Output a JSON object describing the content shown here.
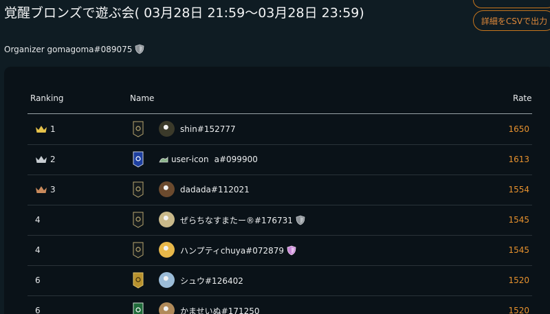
{
  "header": {
    "title": "覚醒ブロンズで遊ぶ会( 03月28日 21:59〜03月28日 23:59)",
    "csv_button": "詳細をCSVで出力",
    "organizer": "Organizer gomagoma#089075"
  },
  "table": {
    "columns": {
      "ranking": "Ranking",
      "name": "Name",
      "rate": "Rate"
    },
    "rows": [
      {
        "rank": "1",
        "crown": "gold",
        "badge": "dark",
        "avatar": "#3b3a2a",
        "name": "shin#152777",
        "shield": "",
        "rate": "1650"
      },
      {
        "rank": "2",
        "crown": "silver",
        "badge": "blue",
        "avatar": "broken",
        "name": "user-icon",
        "name_suffix": "a#099900",
        "shield": "",
        "rate": "1613"
      },
      {
        "rank": "3",
        "crown": "bronze",
        "badge": "dark",
        "avatar": "#6b4a2e",
        "name": "dadada#112021",
        "shield": "",
        "rate": "1554"
      },
      {
        "rank": "4",
        "crown": "",
        "badge": "dark",
        "avatar": "#c9b98a",
        "name": "ぜらちなすまたー®#176731",
        "shield": "gray",
        "rate": "1545"
      },
      {
        "rank": "4",
        "crown": "",
        "badge": "dark",
        "avatar": "#e8b84a",
        "name": "ハンプティchuya#072879",
        "shield": "pink",
        "rate": "1545"
      },
      {
        "rank": "6",
        "crown": "",
        "badge": "gold",
        "avatar": "#9bbcd8",
        "name": "シュウ#126402",
        "shield": "",
        "rate": "1520"
      },
      {
        "rank": "6",
        "crown": "",
        "badge": "green",
        "avatar": "#b08a5a",
        "name": "かませいぬ#171250",
        "shield": "",
        "rate": "1520"
      }
    ]
  },
  "colors": {
    "background": "#0f1c23",
    "panel": "#0a1218",
    "accent": "#e8922e",
    "gold_crown": "#e6c24a",
    "silver_crown": "#c8cdd2",
    "bronze_crown": "#c98a5c"
  }
}
